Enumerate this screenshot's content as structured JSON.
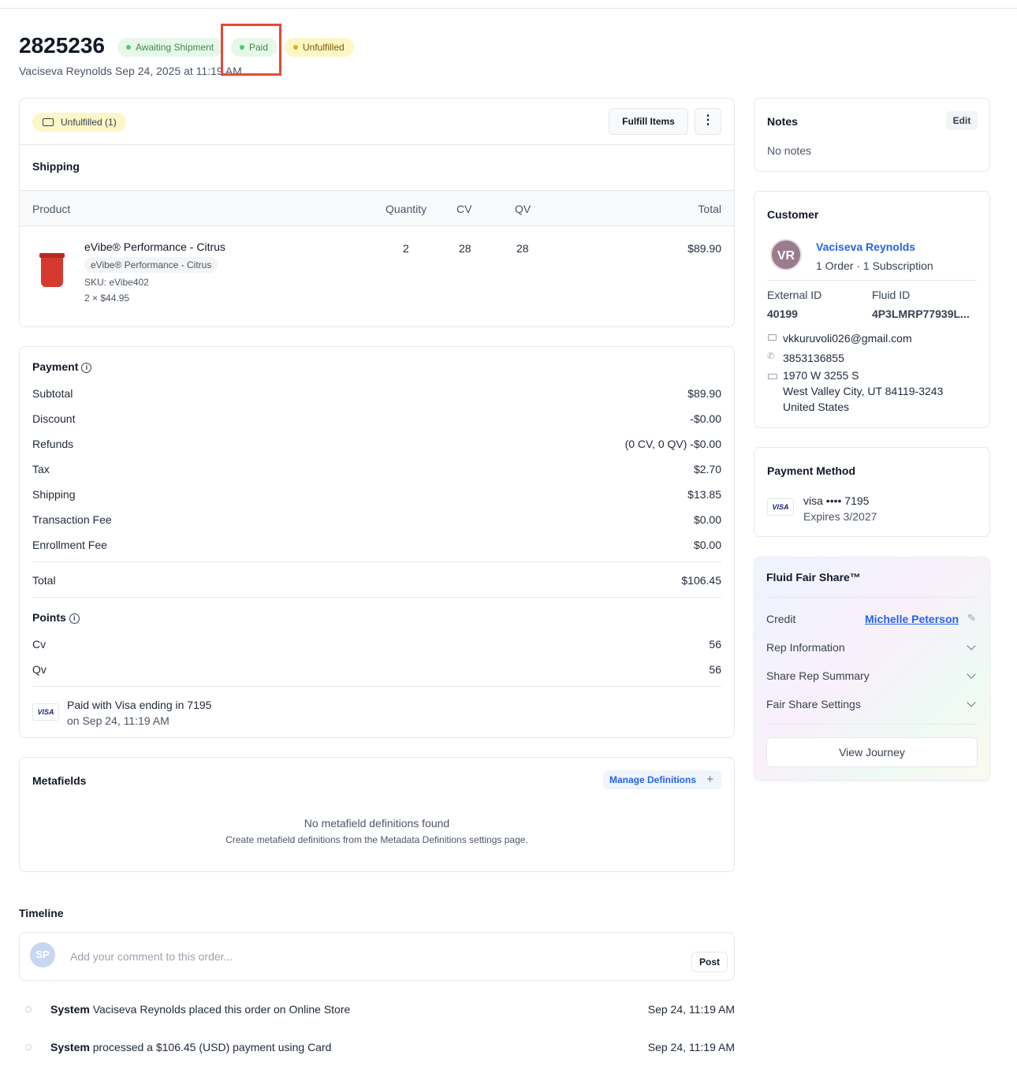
{
  "order": {
    "number": "2825236",
    "subtitle": "Vaciseva Reynolds Sep 24, 2025 at 11:19 AM",
    "badges": {
      "shipment": "Awaiting Shipment",
      "payment": "Paid",
      "fulfillment": "Unfulfilled"
    }
  },
  "fulfillment": {
    "chip": "Unfulfilled (1)",
    "fulfill_button": "Fulfill Items",
    "section_title": "Shipping",
    "columns": {
      "product": "Product",
      "quantity": "Quantity",
      "cv": "CV",
      "qv": "QV",
      "total": "Total"
    },
    "item": {
      "name": "eVibe® Performance - Citrus",
      "variant": "eVibe® Performance - Citrus",
      "sku": "SKU: eVibe402",
      "unit": "2 × $44.95",
      "quantity": "2",
      "cv": "28",
      "qv": "28",
      "total": "$89.90"
    }
  },
  "payment": {
    "title": "Payment",
    "rows": [
      {
        "label": "Subtotal",
        "value": "$89.90"
      },
      {
        "label": "Discount",
        "value": "-$0.00"
      },
      {
        "label": "Refunds",
        "value": "(0 CV, 0 QV) -$0.00"
      },
      {
        "label": "Tax",
        "value": "$2.70"
      },
      {
        "label": "Shipping",
        "value": "$13.85"
      },
      {
        "label": "Transaction Fee",
        "value": "$0.00"
      },
      {
        "label": "Enrollment Fee",
        "value": "$0.00"
      }
    ],
    "total_label": "Total",
    "total_value": "$106.45",
    "points_title": "Points",
    "points": [
      {
        "label": "Cv",
        "value": "56"
      },
      {
        "label": "Qv",
        "value": "56"
      }
    ],
    "paid_with": "Paid with Visa ending in 7195",
    "paid_on": "on Sep 24, 11:19 AM",
    "visa_mark": "VISA"
  },
  "metafields": {
    "title": "Metafields",
    "manage_button": "Manage Definitions",
    "empty_title": "No metafield definitions found",
    "empty_desc": "Create metafield definitions from the Metadata Definitions settings page."
  },
  "timeline": {
    "title": "Timeline",
    "avatar": "SP",
    "placeholder": "Add your comment to this order...",
    "post_button": "Post",
    "events": [
      {
        "actor": "System",
        "text": "Vaciseva Reynolds placed this order on Online Store",
        "time": "Sep 24, 11:19 AM"
      },
      {
        "actor": "System",
        "text": "processed a $106.45 (USD) payment using Card",
        "time": "Sep 24, 11:19 AM"
      }
    ]
  },
  "notes": {
    "title": "Notes",
    "edit": "Edit",
    "empty": "No notes"
  },
  "customer": {
    "title": "Customer",
    "initials": "VR",
    "name": "Vaciseva Reynolds",
    "orders": "1 Order",
    "separator": "·",
    "subscriptions": "1 Subscription",
    "external_id_label": "External ID",
    "external_id": "40199",
    "fluid_id_label": "Fluid ID",
    "fluid_id": "4P3LMRP77939L...",
    "email": "vkkuruvoli026@gmail.com",
    "phone": "3853136855",
    "address_line1": "1970 W 3255 S",
    "address_line2": "West Valley City, UT 84119-3243",
    "country": "United States"
  },
  "payment_method": {
    "title": "Payment Method",
    "card": "visa •••• 7195",
    "expires": "Expires 3/2027",
    "visa_mark": "VISA"
  },
  "fair_share": {
    "title": "Fluid Fair Share™",
    "credit_label": "Credit",
    "credit_name": "Michelle Peterson",
    "rep_information": "Rep Information",
    "share_rep_summary": "Share Rep Summary",
    "settings": "Fair Share Settings",
    "view_journey": "View Journey"
  },
  "colors": {
    "accent": "#2563eb",
    "paid_badge": "#e7f7ea",
    "unfulfilled_badge": "#fdf6c6",
    "highlight": "#e34a33"
  }
}
